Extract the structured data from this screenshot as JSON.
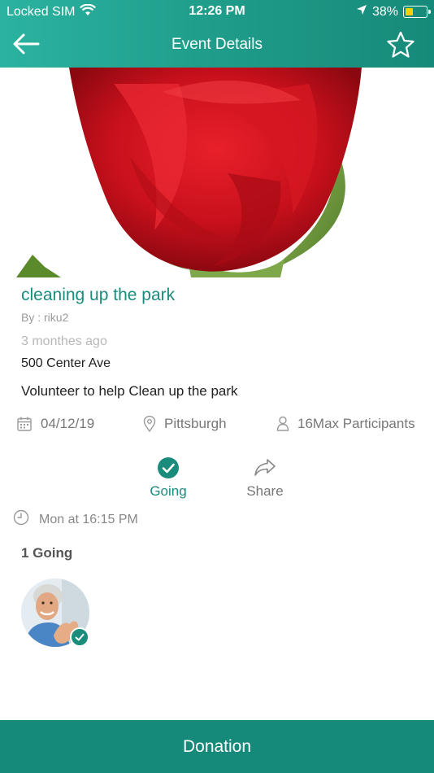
{
  "status_bar": {
    "carrier": "Locked SIM",
    "time": "12:26 PM",
    "battery": "38%",
    "battery_level": 0.38
  },
  "nav": {
    "title": "Event Details",
    "back_icon": "arrow-left-icon",
    "favorite_icon": "star-outline-icon"
  },
  "event": {
    "image_subject": "red-rose-image",
    "title": "cleaning up the park",
    "author": "By : riku2",
    "posted_ago": "3 monthes ago",
    "address": "500 Center Ave",
    "description": "Volunteer to help Clean up the park",
    "date": "04/12/19",
    "location": "Pittsburgh",
    "participants": "16Max Participants",
    "schedule": "Mon at 16:15 PM"
  },
  "actions": {
    "going_label": "Going",
    "share_label": "Share"
  },
  "attendees": {
    "count_label": "1 Going",
    "list": [
      {
        "avatar": "user-avatar",
        "status": "going"
      }
    ]
  },
  "footer": {
    "donation_label": "Donation"
  },
  "colors": {
    "accent": "#1a8c7c",
    "header_start": "#2bb3a0",
    "header_end": "#168a7a",
    "button": "#168a7a",
    "muted": "#777777"
  }
}
